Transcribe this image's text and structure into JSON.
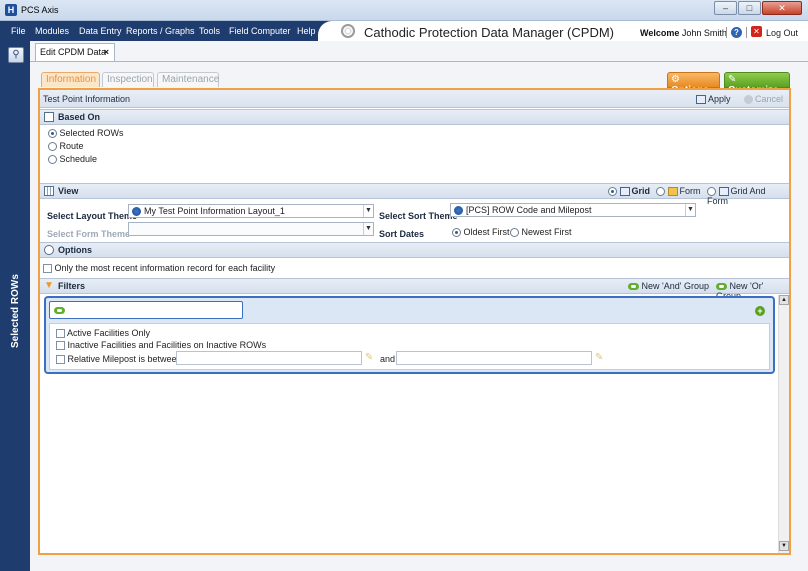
{
  "window": {
    "title": "PCS Axis",
    "logo_letter": "H"
  },
  "menu": {
    "items": [
      "File",
      "Modules",
      "Data Entry",
      "Reports / Graphs",
      "Tools",
      "Field Computer",
      "Help"
    ]
  },
  "header": {
    "app_title": "Cathodic Protection Data Manager (CPDM)",
    "welcome_label": "Welcome",
    "user_name": "John Smith",
    "logout": "Log Out"
  },
  "sidebar": {
    "label": "Selected ROWs"
  },
  "doc_tab": {
    "label": "Edit CPDM Data",
    "close": "×"
  },
  "subtabs": [
    {
      "label": "Information",
      "active": true
    },
    {
      "label": "Inspection",
      "active": false
    },
    {
      "label": "Maintenance",
      "active": false
    }
  ],
  "actions": {
    "options": "Options",
    "customize": "Customize"
  },
  "panel": {
    "title": "Test Point Information",
    "apply": "Apply",
    "cancel": "Cancel"
  },
  "based_on": {
    "header": "Based On",
    "options": [
      "Selected ROWs",
      "Route",
      "Schedule"
    ],
    "selected": "Selected ROWs"
  },
  "view": {
    "header": "View",
    "modes": [
      "Grid",
      "Form",
      "Grid And Form"
    ],
    "selected_mode": "Grid",
    "layout_theme_label": "Select Layout Theme",
    "layout_theme_value": "My Test Point Information Layout_1",
    "form_theme_label": "Select Form Theme",
    "form_theme_value": "",
    "sort_theme_label": "Select Sort Theme",
    "sort_theme_value": "[PCS] ROW Code and Milepost",
    "sort_dates_label": "Sort Dates",
    "sort_dates_options": [
      "Oldest First",
      "Newest First"
    ],
    "sort_dates_selected": "Oldest First"
  },
  "options": {
    "header": "Options",
    "recent_only_label": "Only the most recent information record for each facility",
    "recent_only_checked": false
  },
  "filters": {
    "header": "Filters",
    "new_and": "New 'And' Group",
    "new_or": "New 'Or' Group",
    "items": [
      {
        "label": "Active Facilities Only",
        "checked": false
      },
      {
        "label": "Inactive Facilities and Facilities on Inactive ROWs",
        "checked": false
      },
      {
        "label": "Relative Milepost is between",
        "checked": false
      }
    ],
    "and_label": "and"
  },
  "colors": {
    "navy": "#1e3d6e",
    "orange_accent": "#f0a045",
    "green_accent": "#5aa11f",
    "filter_blue": "#3b6fc2"
  }
}
